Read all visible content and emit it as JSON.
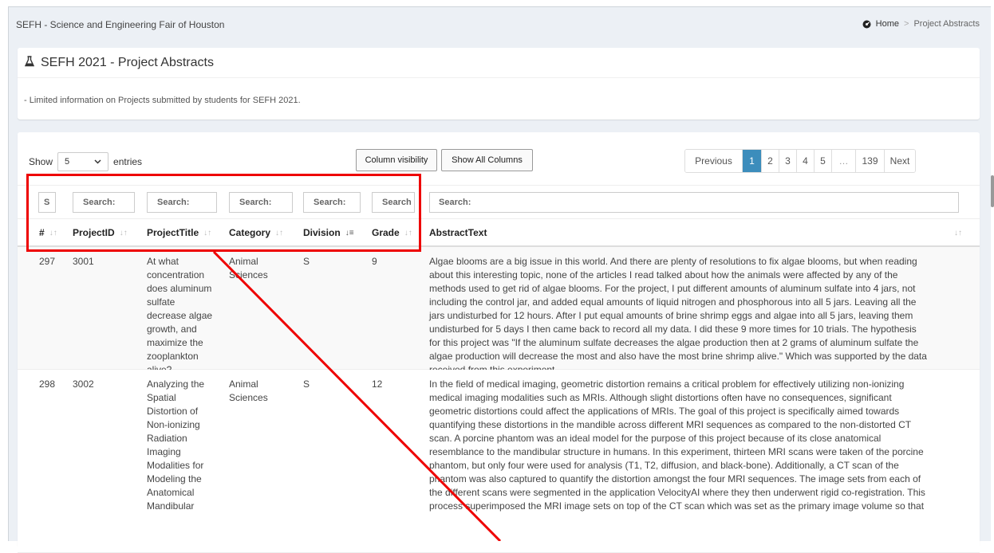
{
  "header": {
    "site_title": "SEFH - Science and Engineering Fair of Houston",
    "breadcrumb": {
      "home": "Home",
      "current": "Project Abstracts"
    }
  },
  "intro_box": {
    "title": "SEFH 2021 - Project Abstracts",
    "description": "- Limited information on Projects submitted by students for SEFH 2021."
  },
  "controls": {
    "show_label": "Show",
    "entries_value": "5",
    "entries_label": "entries",
    "column_visibility": "Column visibility",
    "show_all_columns": "Show All Columns"
  },
  "pagination": {
    "previous": "Previous",
    "pages": [
      "1",
      "2",
      "3",
      "4",
      "5",
      "…",
      "139"
    ],
    "active": "1",
    "next": "Next"
  },
  "filters": {
    "idx": "S",
    "project_id": "Search:",
    "project_title": "Search:",
    "category": "Search:",
    "division": "Search:",
    "grade": "Search",
    "abstract": "Search:"
  },
  "columns": {
    "idx": "#",
    "project_id": "ProjectID",
    "project_title": "ProjectTitle",
    "category": "Category",
    "division": "Division",
    "grade": "Grade",
    "abstract": "AbstractText"
  },
  "rows": [
    {
      "idx": "297",
      "project_id": "3001",
      "project_title_lines": [
        "At what",
        "concentration",
        "does aluminum",
        "sulfate",
        "decrease algae",
        "growth, and",
        "maximize the",
        "zooplankton",
        "alive?"
      ],
      "category_lines": [
        "Animal",
        "Sciences"
      ],
      "division": "S",
      "grade": "9",
      "abstract_lines": [
        "Algae blooms are a big issue in this world. And there are plenty of resolutions to fix algae blooms, but when reading",
        "about this interesting topic, none of the articles I read talked about how the animals were affected by any of the",
        "methods used to get rid of algae blooms. For the project, I put different amounts of aluminum sulfate into 4 jars, not",
        "including the control jar, and added equal amounts of liquid nitrogen and phosphorous into all 5 jars. Leaving all the",
        "jars undisturbed for 12 hours. After I put equal amounts of brine shrimp eggs and algae into all 5 jars, leaving them",
        "undisturbed for 5 days I then came back to record all my data. I did these 9 more times for 10 trials. The hypothesis",
        "for this project was \"If the aluminum sulfate decreases the algae production then at 2 grams of aluminum sulfate the",
        "algae production will decrease the most and also have the most brine shrimp alive.\" Which was supported by the data",
        "received from this experiment."
      ]
    },
    {
      "idx": "298",
      "project_id": "3002",
      "project_title_lines": [
        "Analyzing the",
        "Spatial",
        "Distortion of",
        "Non-ionizing",
        "Radiation",
        "Imaging",
        "Modalities for",
        "Modeling the",
        "Anatomical",
        "Mandibular"
      ],
      "category_lines": [
        "Animal",
        "Sciences"
      ],
      "division": "S",
      "grade": "12",
      "abstract_lines": [
        "In the field of medical imaging, geometric distortion remains a critical problem for effectively utilizing non-ionizing",
        "medical imaging modalities such as MRIs. Although slight distortions often have no consequences, significant",
        "geometric distortions could affect the applications of MRIs. The goal of this project is specifically aimed towards",
        "quantifying these distortions in the mandible across different MRI sequences as compared to the non-distorted CT",
        "scan. A porcine phantom was an ideal model for the purpose of this project because of its close anatomical",
        "resemblance to the mandibular structure in humans. In this experiment, thirteen MRI scans were taken of the porcine",
        "phantom, but only four were used for analysis (T1, T2, diffusion, and black-bone). Additionally, a CT scan of the",
        "phantom was also captured to quantify the distortion amongst the four MRI sequences. The image sets from each of",
        "the different scans were segmented in the application VelocityAI where they then underwent rigid co-registration. This",
        "process superimposed the MRI image sets on top of the CT scan which was set as the primary image volume so that"
      ]
    }
  ],
  "colors": {
    "accent": "#3c8dbc",
    "highlight": "#e00000"
  }
}
